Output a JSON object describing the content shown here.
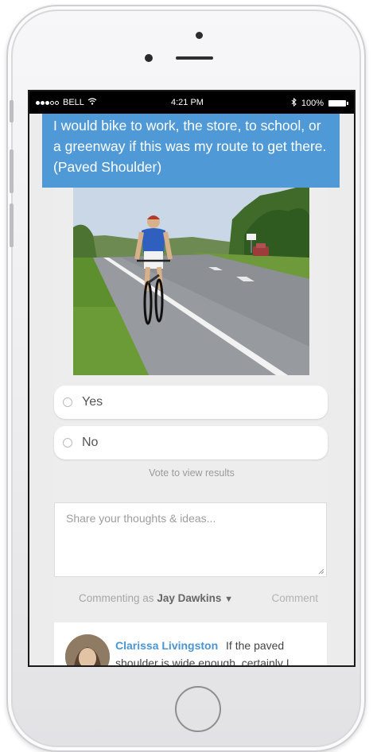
{
  "status_bar": {
    "carrier": "BELL",
    "time": "4:21 PM",
    "battery": "100%"
  },
  "question": {
    "text": "I would bike to work, the store, to school, or a greenway if this was my route to get there. (Paved Shoulder)"
  },
  "options": [
    {
      "label": "Yes"
    },
    {
      "label": "No"
    }
  ],
  "vote_note": "Vote to view results",
  "comment_box": {
    "placeholder": "Share your thoughts & ideas..."
  },
  "commenting": {
    "prefix": "Commenting as",
    "user": "Jay Dawkins",
    "comment_label": "Comment"
  },
  "comment": {
    "author": "Clarissa Livingston",
    "text": "If the paved shoulder is wide enough, certainly I"
  },
  "colors": {
    "accent": "#4f9ad6",
    "author": "#4c95d1"
  }
}
